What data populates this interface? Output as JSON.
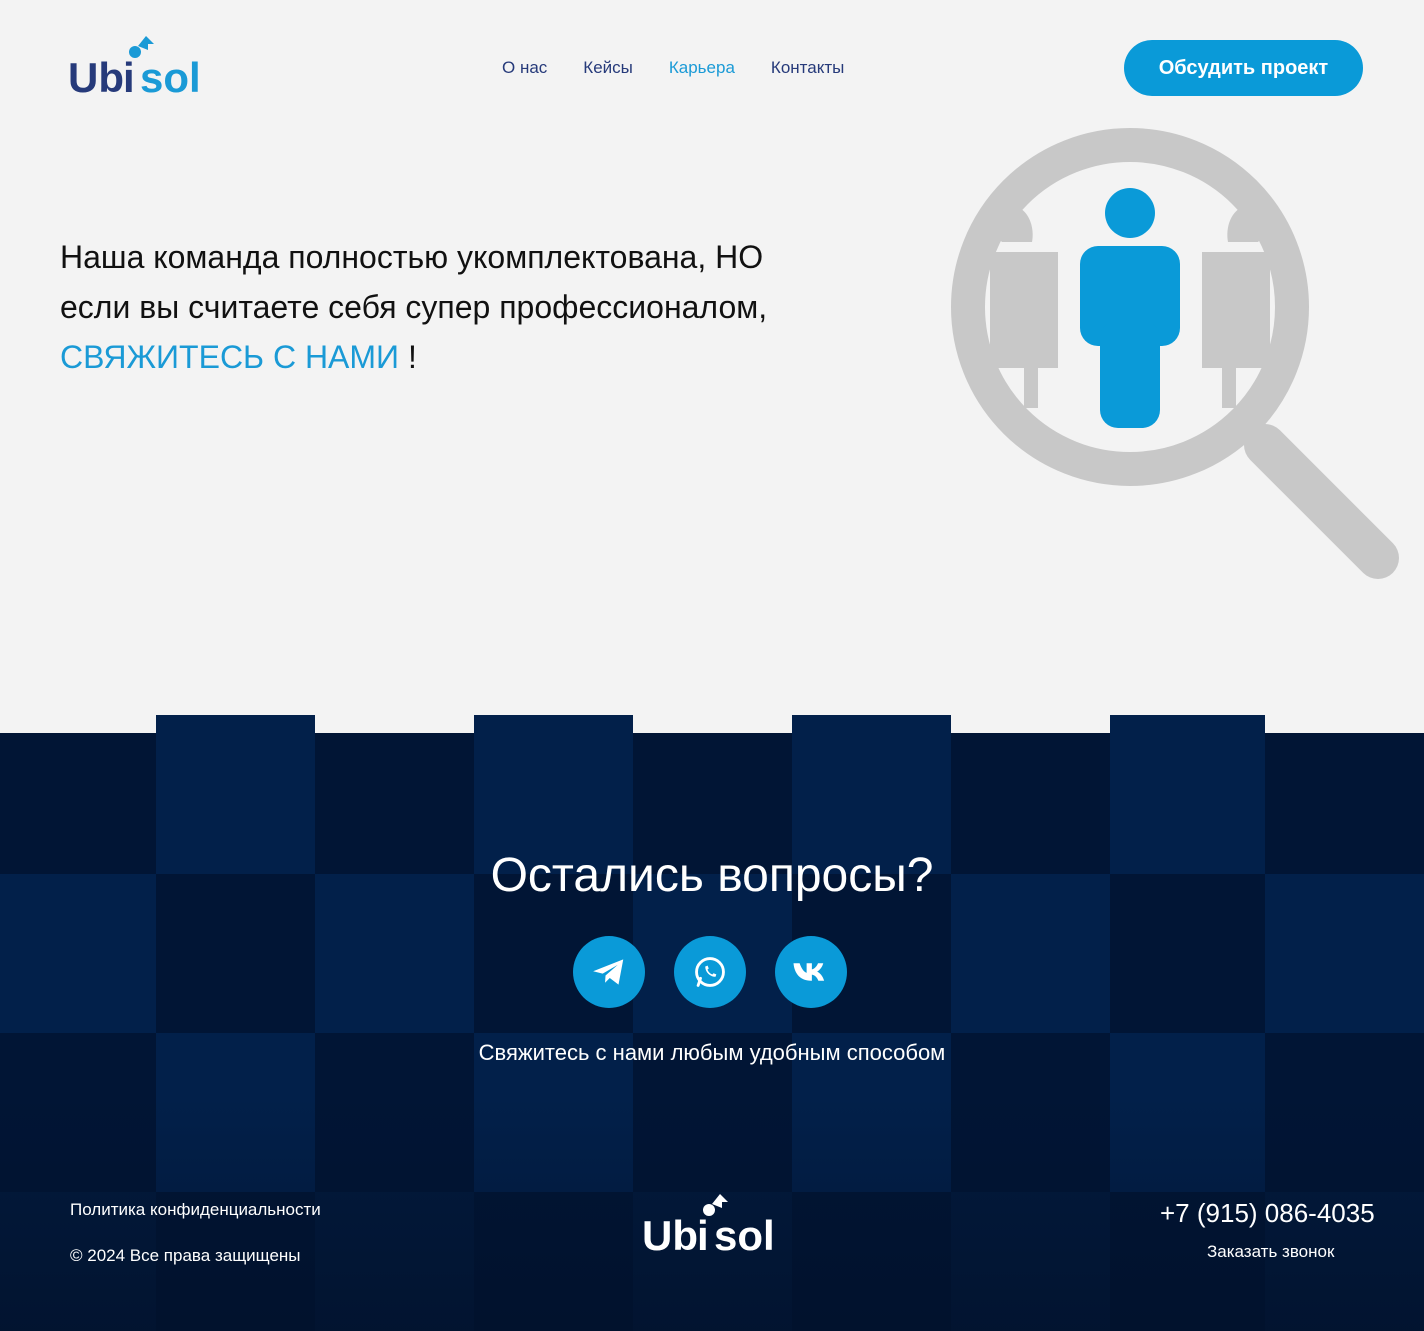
{
  "header": {
    "logo_text": "Ubisol",
    "nav": [
      {
        "label": "О нас"
      },
      {
        "label": "Кейсы"
      },
      {
        "label": "Карьера"
      },
      {
        "label": "Контакты"
      }
    ],
    "active_nav": "Карьера",
    "cta_label": "Обсудить проект"
  },
  "hero": {
    "line1": "Наша команда полностью укомплектована, НО",
    "line2": "если вы считаете себя супер профессионалом,",
    "accent": "СВЯЖИТЕСЬ С НАМИ",
    "suffix": " !",
    "illustration": "magnifier-person-icon"
  },
  "footer": {
    "heading": "Остались вопросы?",
    "socials": [
      {
        "name": "telegram-icon"
      },
      {
        "name": "whatsapp-icon"
      },
      {
        "name": "vk-icon"
      }
    ],
    "contact_line": "Свяжитесь с нами любым удобным способом",
    "policy": "Политика конфиденциальности",
    "copyright": "© 2024 Все права защищены",
    "logo_text": "Ubisol",
    "phone": "+7 (915) 086-4035",
    "callback": "Заказать звонок"
  },
  "colors": {
    "accent": "#0a9ad8",
    "nav_text": "#263a7a",
    "footer_dark": "#011535",
    "footer_light": "#02204a",
    "page_bg": "#f3f3f3"
  }
}
